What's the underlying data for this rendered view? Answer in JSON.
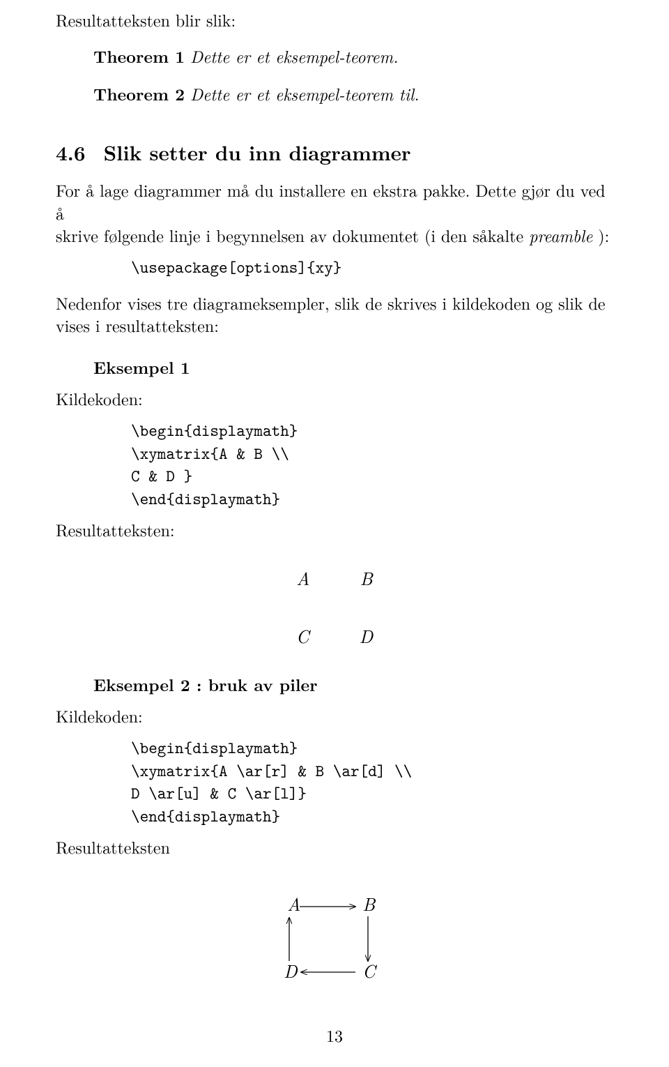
{
  "intro_line": "Resultatteksten blir slik:",
  "theorem1_label": "Theorem 1",
  "theorem1_text": "Dette er et eksempel-teorem.",
  "theorem2_label": "Theorem 2",
  "theorem2_text": "Dette er et eksempel-teorem til.",
  "section_number": "4.6",
  "section_title": "Slik setter du inn diagrammer",
  "body1_a": "For å lage diagrammer må du installere en ekstra pakke. Dette gjør du ved å",
  "body1_b": "skrive følgende linje i begynnelsen av dokumentet (i den såkalte ",
  "preamble_word": "preamble",
  "body1_c": " ):",
  "code_usepackage": "\\usepackage[options]{xy}",
  "body2_a": "Nedenfor vises tre diagrameksempler, slik de skrives i kildekoden og slik de",
  "body2_b": "vises i resultatteksten:",
  "example1_title": "Eksempel 1",
  "kildekoden_label": "Kildekoden:",
  "ex1_code_l1": "\\begin{displaymath}",
  "ex1_code_l2": "\\xymatrix{A & B \\\\",
  "ex1_code_l3": "C & D }",
  "ex1_code_l4": "\\end{displaymath}",
  "resultatteksten_label": "Resultatteksten:",
  "diagram1": {
    "A": "A",
    "B": "B",
    "C": "C",
    "D": "D"
  },
  "example2_title": "Eksempel 2 : bruk av piler",
  "ex2_code_l1": "\\begin{displaymath}",
  "ex2_code_l2": "\\xymatrix{A \\ar[r] & B \\ar[d] \\\\",
  "ex2_code_l3": "D \\ar[u] & C \\ar[l]}",
  "ex2_code_l4": "\\end{displaymath}",
  "resultatteksten2_label": "Resultatteksten",
  "diagram2": {
    "A": "A",
    "B": "B",
    "C": "C",
    "D": "D"
  },
  "page_number": "13"
}
